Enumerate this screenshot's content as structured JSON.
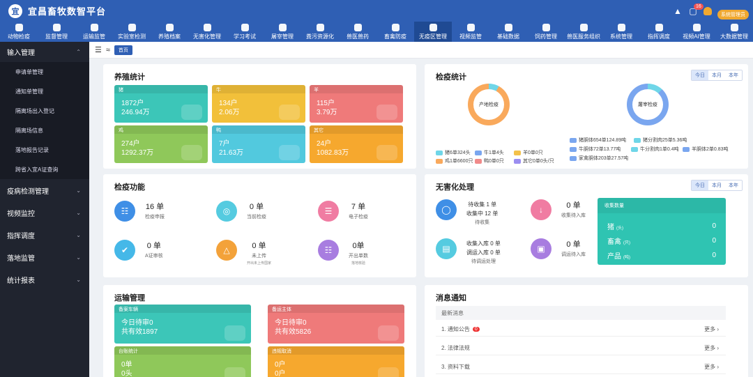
{
  "header": {
    "logo_text": "宜",
    "title": "宜昌畜牧数智平台",
    "msg_count": "16",
    "user_btn": "系统管理员"
  },
  "nav": [
    "动物检疫",
    "监督管理",
    "运输监管",
    "实验室检测",
    "养殖档案",
    "无害化管理",
    "学习考试",
    "屠宰管理",
    "粪污资源化",
    "兽医兽药",
    "畜禽防疫",
    "无疫区管理",
    "视频监管",
    "基础数据",
    "饲药管理",
    "兽医服务组织",
    "系统管理",
    "指挥调度",
    "视频AI管理",
    "大数据管理"
  ],
  "sidebar": {
    "group1": "输入管理",
    "subs": [
      "申请单管理",
      "通知单管理",
      "隔离场出入登记",
      "隔离场信息",
      "落地报告记录",
      "跨省入宜A证查询"
    ],
    "groups": [
      "疫病检测管理",
      "视频监控",
      "指挥调度",
      "落地监管",
      "统计报表"
    ]
  },
  "crumb": "首页",
  "breeding": {
    "title": "养殖统计",
    "tiles": [
      {
        "name": "猪",
        "v1": "1872户",
        "v2": "246.94万",
        "color": "#3cc6b8"
      },
      {
        "name": "牛",
        "v1": "134户",
        "v2": "2.06万",
        "color": "#f2c03a"
      },
      {
        "name": "羊",
        "v1": "115户",
        "v2": "3.79万",
        "color": "#ef7a7a"
      },
      {
        "name": "鸡",
        "v1": "274户",
        "v2": "1292.37万",
        "color": "#8fc85a"
      },
      {
        "name": "鸭",
        "v1": "7户",
        "v2": "21.63万",
        "color": "#52c9de"
      },
      {
        "name": "其它",
        "v1": "24户",
        "v2": "1082.83万",
        "color": "#f6a82e"
      }
    ]
  },
  "quarantine": {
    "title": "检疫统计",
    "seg": [
      "今日",
      "本月",
      "本年"
    ],
    "donut1": "产地检疫",
    "donut2": "屠宰检疫",
    "leg1": [
      {
        "t": "猪6单324头",
        "c": "#6fd6e8"
      },
      {
        "t": "牛1单4头",
        "c": "#7aa6ef"
      },
      {
        "t": "羊0单0只",
        "c": "#f3c14a"
      },
      {
        "t": "鸡1单6600只",
        "c": "#f9a95c"
      },
      {
        "t": "鸭0单0只",
        "c": "#f08a8a"
      },
      {
        "t": "其它0单0头/只",
        "c": "#9b8ef0"
      }
    ],
    "leg2": [
      {
        "t": "猪胴体654单124.89吨",
        "c": "#7aa6ef"
      },
      {
        "t": "猪分割肉25单5.36吨",
        "c": "#6fd6e8"
      },
      {
        "t": "牛胴体72单13.77吨",
        "c": "#7aa6ef"
      },
      {
        "t": "牛分割肉1单0.4吨",
        "c": "#6fd6e8"
      },
      {
        "t": "羊胴体2单0.83吨",
        "c": "#7aa6ef"
      },
      {
        "t": "家禽胴体203单27.57吨",
        "c": "#7aa6ef"
      }
    ]
  },
  "functions": {
    "title": "检疫功能",
    "items": [
      {
        "big": "16 单",
        "small": "检疫申报",
        "tiny": "",
        "color": "#3f8fe6"
      },
      {
        "big": "0 单",
        "small": "当前检疫",
        "tiny": "",
        "color": "#55cbe0"
      },
      {
        "big": "7 单",
        "small": "电子检疫",
        "tiny": "",
        "color": "#f07ca2"
      },
      {
        "big": "0 单",
        "small": "A证审核",
        "tiny": "",
        "color": "#45b8e8"
      },
      {
        "big": "0 单",
        "small": "未上传",
        "tiny": "开出未上传国家",
        "color": "#f3a23a"
      },
      {
        "big": "0单",
        "small": "开出单数",
        "tiny": "落地核验",
        "color": "#a87de0"
      }
    ]
  },
  "harmless": {
    "title": "无害化处理",
    "seg": [
      "今日",
      "本月",
      "本年"
    ],
    "a_l1": "待收集 1 单",
    "a_l2": "收集中 12 单",
    "a_sub": "待收集",
    "b_big": "0 单",
    "b_sub": "收集待入库",
    "c_l1": "收集入库 0 单",
    "c_l2": "调运入库 0 单",
    "c_sub": "待调运处理",
    "d_big": "0 单",
    "d_sub": "调运待入库",
    "box_title": "收集数量",
    "rows": [
      {
        "k": "猪",
        "u": "(头)",
        "v": "0"
      },
      {
        "k": "畜禽",
        "u": "(只)",
        "v": "0"
      },
      {
        "k": "产品",
        "u": "(吨)",
        "v": "0"
      }
    ]
  },
  "transport": {
    "title": "运输管理",
    "tiles": [
      {
        "h": "备案车辆",
        "l1": "今日待审0",
        "l2": "共有效1897",
        "color": "#3cc6b8"
      },
      {
        "h": "备运主体",
        "l1": "今日待审0",
        "l2": "共有效5826",
        "color": "#ef7a7a"
      },
      {
        "h": "台账统计",
        "l1": "0单",
        "l2": "0头",
        "color": "#8fc85a"
      },
      {
        "h": "违规取消",
        "l1": "0户",
        "l2": "0户",
        "color": "#f6a82e"
      }
    ]
  },
  "notices": {
    "title": "消息通知",
    "header": "最新消息",
    "rows": [
      {
        "t": "1. 通知公告",
        "badge": "0"
      },
      {
        "t": "2. 法律法规",
        "badge": ""
      },
      {
        "t": "3. 资料下载",
        "badge": ""
      }
    ],
    "more": "更多"
  }
}
